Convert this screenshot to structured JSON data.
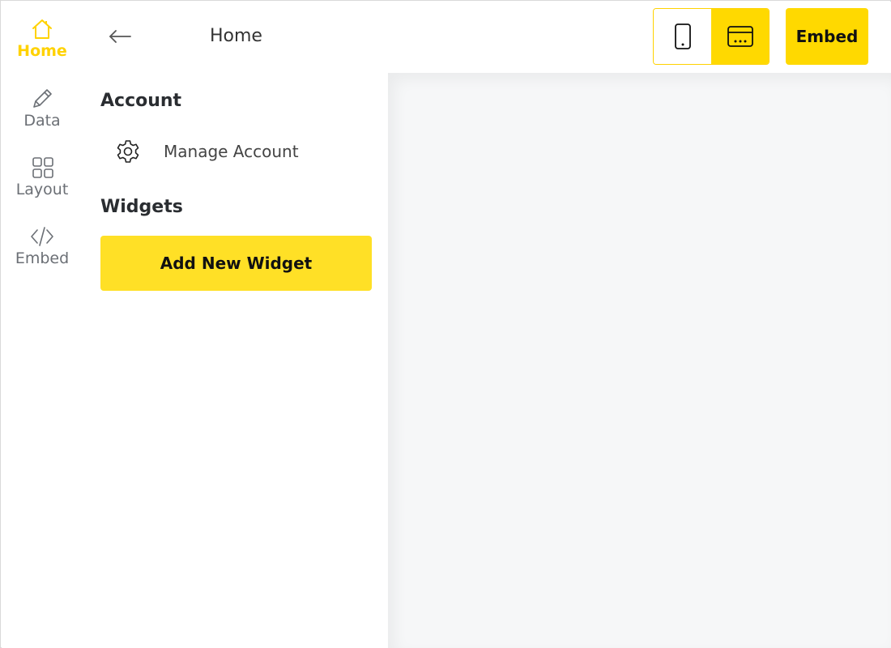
{
  "colors": {
    "accent": "#ffd900",
    "canvas": "#f6f7f8",
    "rail_text": "#6b6f75"
  },
  "rail": {
    "items": [
      {
        "label": "Home",
        "icon": "home-icon",
        "active": true
      },
      {
        "label": "Data",
        "icon": "pencil-icon",
        "active": false
      },
      {
        "label": "Layout",
        "icon": "grid-icon",
        "active": false
      },
      {
        "label": "Embed",
        "icon": "code-icon",
        "active": false
      }
    ]
  },
  "header": {
    "title": "Home",
    "back_icon": "arrow-left-icon",
    "device_toggle": {
      "mobile_icon": "mobile-icon",
      "desktop_icon": "desktop-icon",
      "selected": "desktop"
    },
    "embed_label": "Embed"
  },
  "panel": {
    "account_title": "Account",
    "manage_account_label": "Manage Account",
    "manage_account_icon": "gear-icon",
    "widgets_title": "Widgets",
    "add_widget_label": "Add New Widget"
  }
}
